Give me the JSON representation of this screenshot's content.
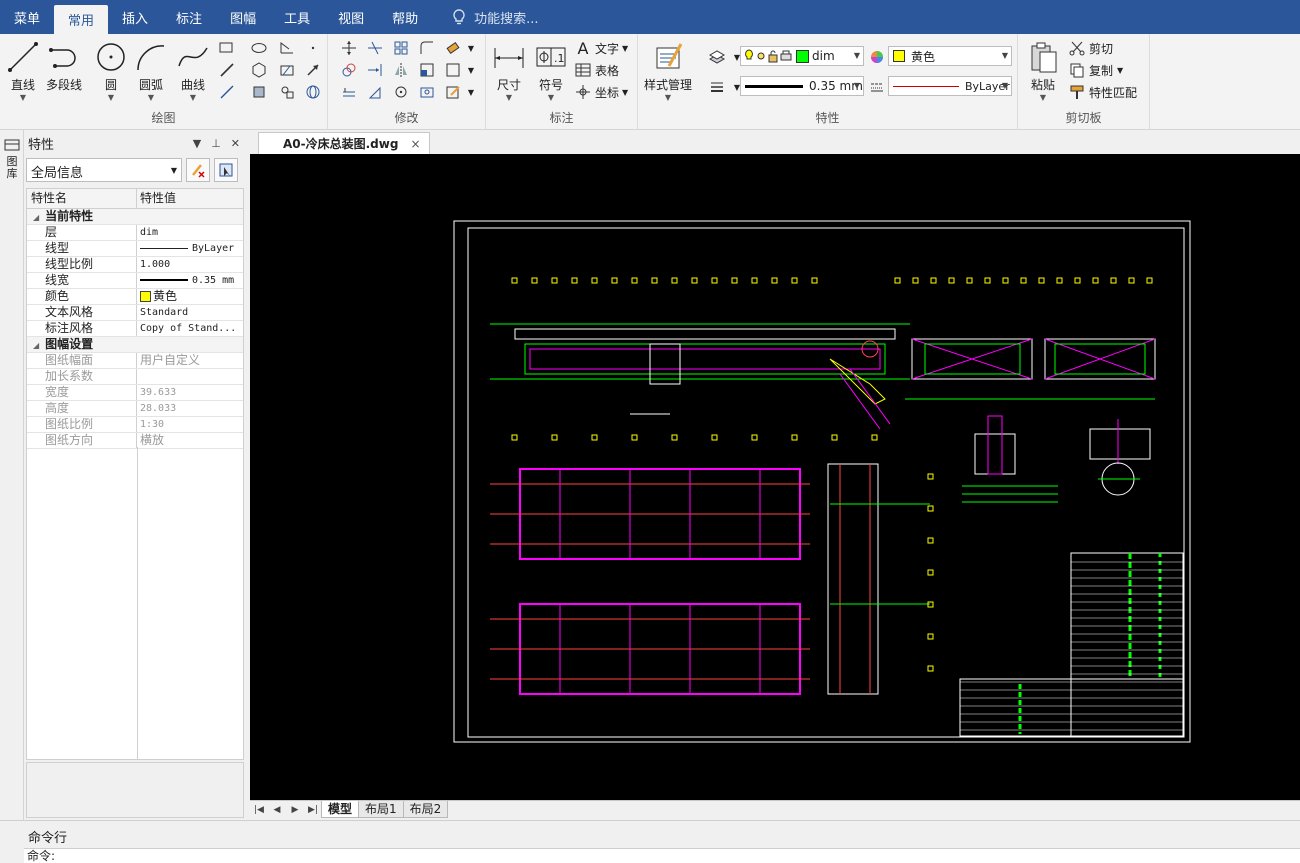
{
  "menubar": {
    "items": [
      "菜单",
      "常用",
      "插入",
      "标注",
      "图幅",
      "工具",
      "视图",
      "帮助"
    ],
    "active": "常用",
    "search_placeholder": "功能搜索..."
  },
  "ribbon": {
    "draw": {
      "label": "绘图",
      "line": "直线",
      "polyline": "多段线",
      "circle": "圆",
      "arc": "圆弧",
      "curve": "曲线"
    },
    "modify": {
      "label": "修改"
    },
    "annotate": {
      "label": "标注",
      "dimension": "尺寸",
      "symbol": "符号",
      "text": "文字",
      "table": "表格",
      "coord": "坐标"
    },
    "properties": {
      "label": "特性",
      "style_manager": "样式管理",
      "layer_value": "dim",
      "color_value": "黄色",
      "lineweight_value": "0.35 mm",
      "linetype_value": "ByLayer"
    },
    "clipboard": {
      "label": "剪切板",
      "paste": "粘贴",
      "cut": "剪切",
      "copy": "复制",
      "match": "特性匹配"
    }
  },
  "left_vtab": {
    "label": "图库"
  },
  "properties_panel": {
    "title": "特性",
    "selector_value": "全局信息",
    "header_name": "特性名",
    "header_value": "特性值",
    "section_current": "当前特性",
    "current": [
      {
        "k": "层",
        "v": "dim"
      },
      {
        "k": "线型",
        "v": "ByLayer"
      },
      {
        "k": "线型比例",
        "v": "1.000"
      },
      {
        "k": "线宽",
        "v": "0.35 mm"
      },
      {
        "k": "颜色",
        "v": "黄色"
      },
      {
        "k": "文本风格",
        "v": "Standard"
      },
      {
        "k": "标注风格",
        "v": "Copy of Stand..."
      }
    ],
    "section_sheet": "图幅设置",
    "sheet": [
      {
        "k": "图纸幅面",
        "v": "用户自定义"
      },
      {
        "k": "加长系数",
        "v": ""
      },
      {
        "k": "宽度",
        "v": "39.633"
      },
      {
        "k": "高度",
        "v": "28.033"
      },
      {
        "k": "图纸比例",
        "v": "1:30"
      },
      {
        "k": "图纸方向",
        "v": "横放"
      }
    ]
  },
  "document": {
    "tab_title": "A0-冷床总装图.dwg",
    "close": "×"
  },
  "layout_tabs": [
    "模型",
    "布局1",
    "布局2"
  ],
  "command": {
    "label": "命令行",
    "prompt": "命令:"
  },
  "colors": {
    "accent": "#2b579a",
    "canvas": "#000000",
    "layer_yellow": "#ffff00"
  }
}
